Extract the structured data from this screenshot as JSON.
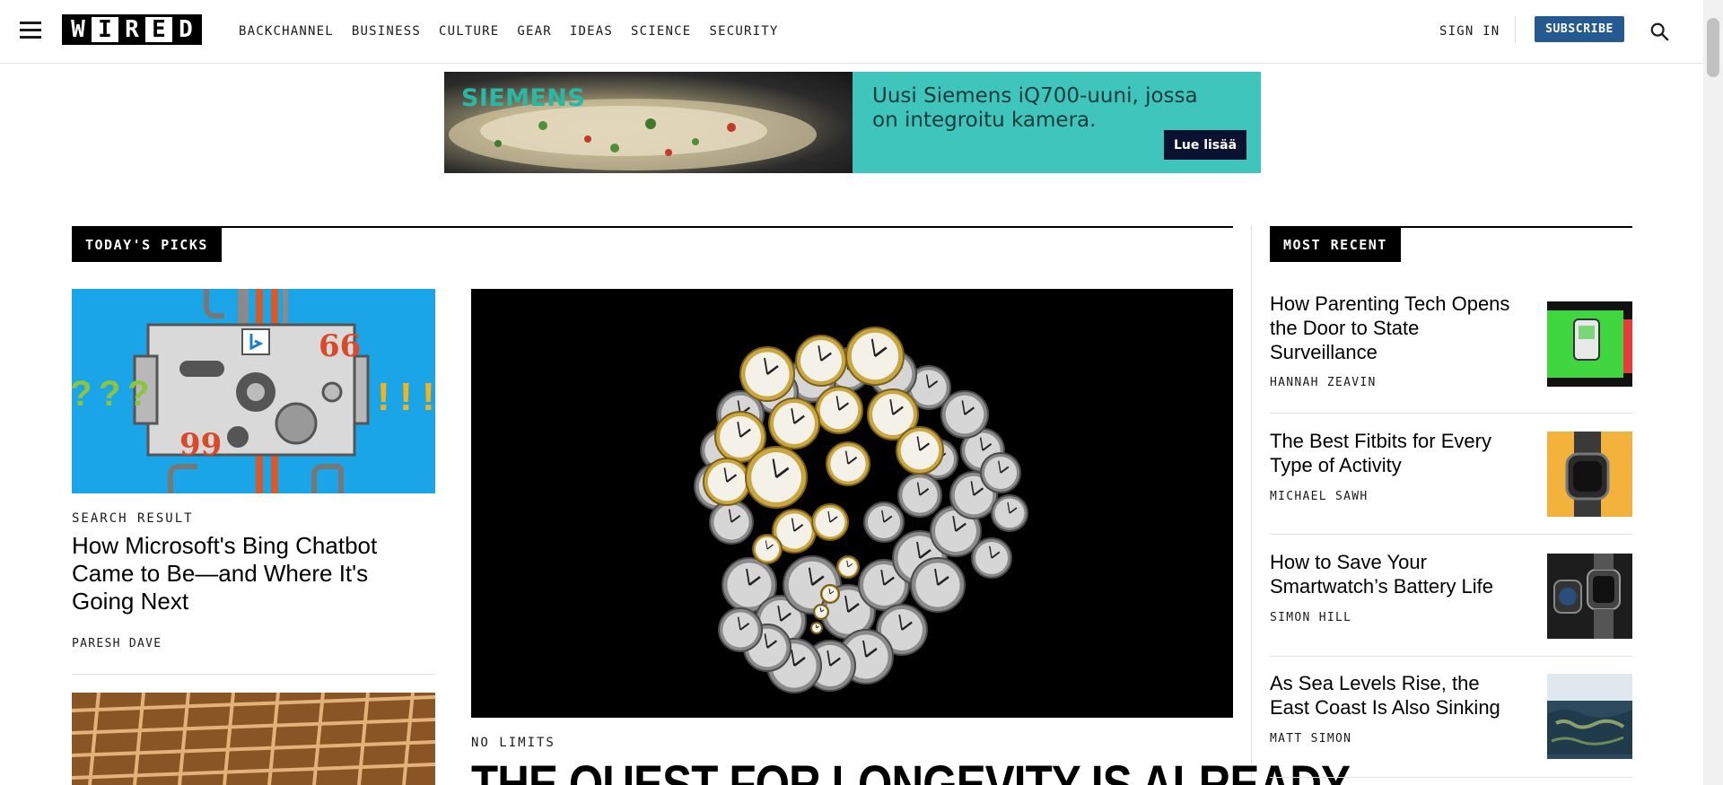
{
  "header": {
    "logo_letters": [
      "W",
      "I",
      "R",
      "E",
      "D"
    ],
    "nav": [
      "BACKCHANNEL",
      "BUSINESS",
      "CULTURE",
      "GEAR",
      "IDEAS",
      "SCIENCE",
      "SECURITY"
    ],
    "sign_in": "SIGN IN",
    "subscribe": "SUBSCRIBE",
    "accent_color": "#245a8f"
  },
  "ad": {
    "brand": "SIEMENS",
    "headline": "Uusi Siemens iQ700-uuni, jossa on integroitu kamera.",
    "cta": "Lue lisää",
    "panel_color": "#3fc5bc"
  },
  "todays_picks": {
    "label": "TODAY'S PICKS",
    "cards": [
      {
        "kicker": "SEARCH RESULT",
        "title": "How Microsoft's Bing Chatbot Came to Be—and Where It's Going Next",
        "byline": "PARESH DAVE"
      }
    ],
    "hero": {
      "kicker": "NO LIMITS",
      "title": "THE QUEST FOR LONGEVITY IS ALREADY"
    }
  },
  "most_recent": {
    "label": "MOST RECENT",
    "items": [
      {
        "title": "How Parenting Tech Opens the Door to State Surveillance",
        "byline": "HANNAH ZEAVIN"
      },
      {
        "title": "The Best Fitbits for Every Type of Activity",
        "byline": "MICHAEL SAWH"
      },
      {
        "title": "How to Save Your Smartwatch’s Battery Life",
        "byline": "SIMON HILL"
      },
      {
        "title": "As Sea Levels Rise, the East Coast Is Also Sinking",
        "byline": "MATT SIMON"
      }
    ]
  }
}
